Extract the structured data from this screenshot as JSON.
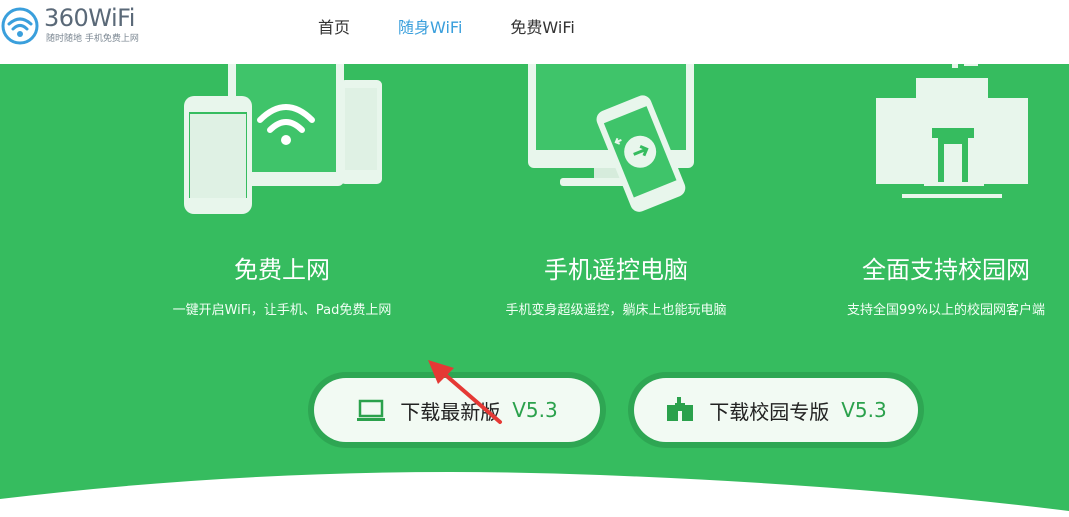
{
  "logo": {
    "text": "360WiFi",
    "subtitle": "随时随地  手机免费上网"
  },
  "nav": [
    {
      "label": "首页",
      "active": false
    },
    {
      "label": "随身WiFi",
      "active": true
    },
    {
      "label": "免费WiFi",
      "active": false
    }
  ],
  "features": [
    {
      "title": "免费上网",
      "desc": "一键开启WiFi，让手机、Pad免费上网"
    },
    {
      "title": "手机遥控电脑",
      "desc": "手机变身超级遥控，躺床上也能玩电脑"
    },
    {
      "title": "全面支持校园网",
      "desc": "支持全国99%以上的校园网客户端"
    }
  ],
  "buttons": {
    "download_latest": {
      "label": "下载最新版",
      "version": "V5.3",
      "icon": "laptop-icon"
    },
    "download_campus": {
      "label": "下载校园专版",
      "version": "V5.3",
      "icon": "campus-building-icon"
    }
  },
  "colors": {
    "brand_green": "#36bc5f",
    "nav_active": "#3a9fdc",
    "version_green": "#2ba14c",
    "annotation_red": "#e53935"
  }
}
